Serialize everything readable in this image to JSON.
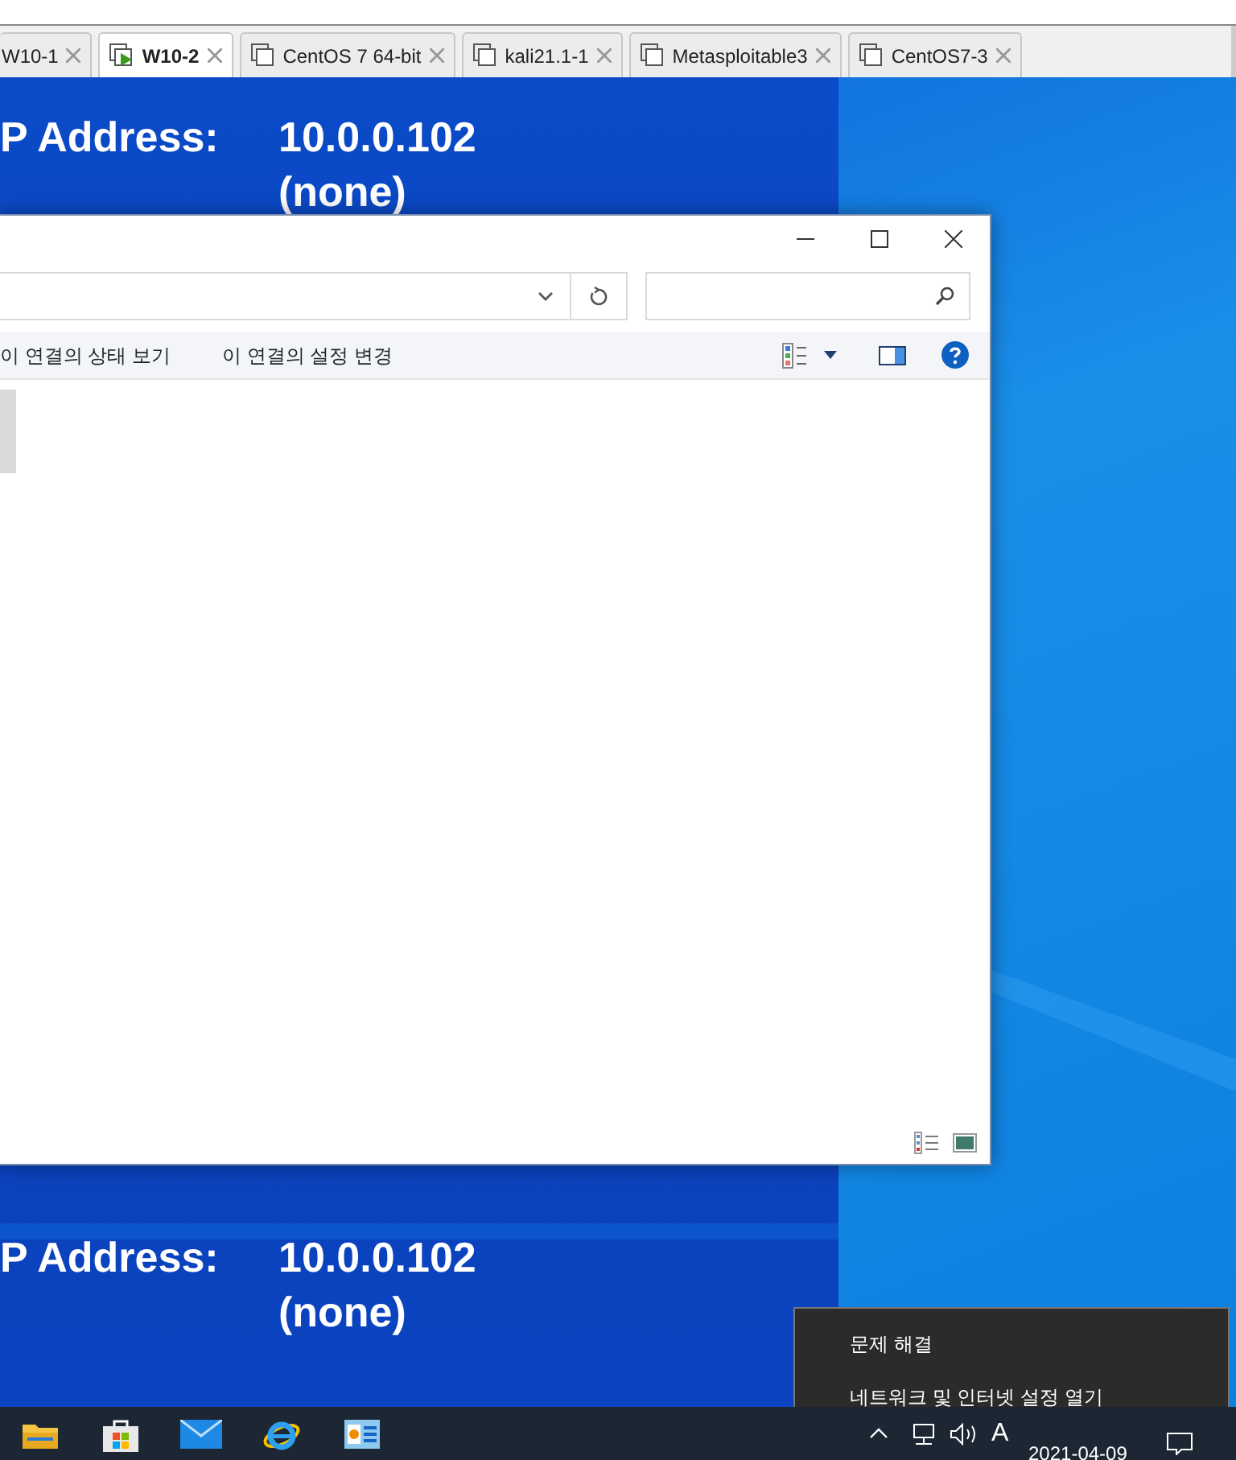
{
  "vm_tabs": [
    {
      "label": "W10-1",
      "selected": false
    },
    {
      "label": "W10-2",
      "selected": true,
      "running": true
    },
    {
      "label": "CentOS 7 64-bit",
      "selected": false,
      "running": false
    },
    {
      "label": "kali21.1-1",
      "selected": false,
      "running": false
    },
    {
      "label": "Metasploitable3",
      "selected": false,
      "running": false
    },
    {
      "label": "CentOS7-3",
      "selected": false,
      "running": false
    }
  ],
  "wallpaper_info": [
    {
      "label": "P Address:",
      "values": [
        "10.0.0.102",
        "(none)"
      ]
    },
    {
      "label": "P Address:",
      "values": [
        "10.0.0.102",
        "(none)"
      ]
    }
  ],
  "explorer": {
    "commands": [
      "이 연결의 상태 보기",
      "이 연결의 설정 변경"
    ],
    "items": [
      {
        "selected": true
      }
    ]
  },
  "context_menu": {
    "items": [
      "문제 해결",
      "네트워크 및 인터넷 설정 열기"
    ]
  },
  "taskbar": {
    "input_indicator": "A",
    "date": "2021-04-09"
  }
}
